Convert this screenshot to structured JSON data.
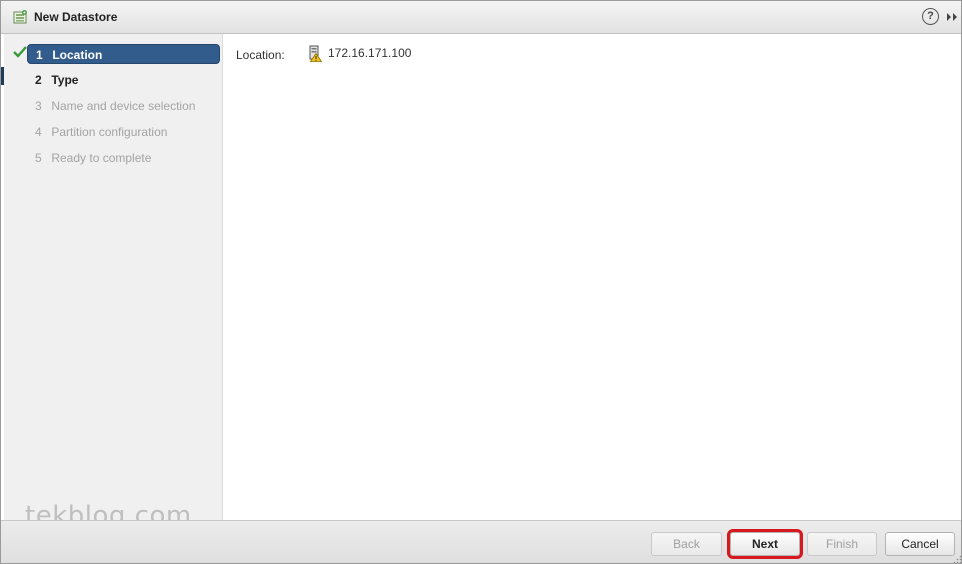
{
  "dialog": {
    "title": "New Datastore",
    "help_glyph": "?"
  },
  "steps": [
    {
      "num": "1",
      "label": "Location",
      "state": "done-active"
    },
    {
      "num": "2",
      "label": "Type",
      "state": "current"
    },
    {
      "num": "3",
      "label": "Name and device selection",
      "state": "disabled"
    },
    {
      "num": "4",
      "label": "Partition configuration",
      "state": "disabled"
    },
    {
      "num": "5",
      "label": "Ready to complete",
      "state": "disabled"
    }
  ],
  "content": {
    "location_label": "Location:",
    "location_value": "172.16.171.100",
    "location_icon": "host-warning-icon"
  },
  "buttons": {
    "back": "Back",
    "next": "Next",
    "finish": "Finish",
    "cancel": "Cancel"
  },
  "watermark": "tekbloq.com",
  "colors": {
    "active_step": "#325c8c",
    "highlight": "#d7191f",
    "check": "#3a9a3a"
  }
}
